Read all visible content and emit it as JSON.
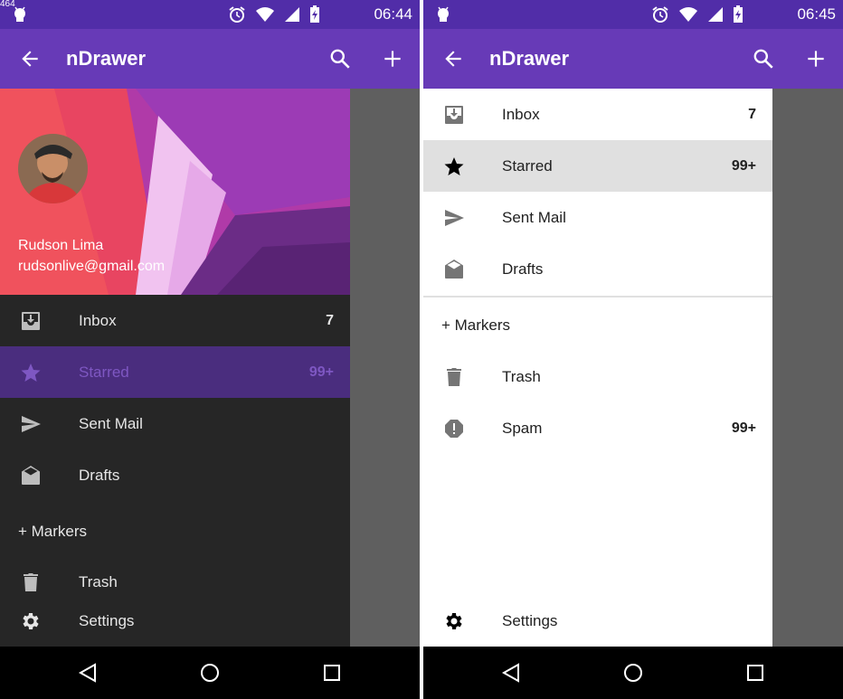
{
  "corner_label": "464",
  "app": {
    "title": "nDrawer"
  },
  "left": {
    "time": "06:44",
    "user": {
      "name": "Rudson Lima",
      "email": "rudsonlive@gmail.com"
    },
    "items": [
      {
        "label": "Inbox",
        "count": "7",
        "icon": "inbox-icon"
      },
      {
        "label": "Starred",
        "count": "99+",
        "icon": "star-icon"
      },
      {
        "label": "Sent Mail",
        "count": "",
        "icon": "send-icon"
      },
      {
        "label": "Drafts",
        "count": "",
        "icon": "drafts-icon"
      }
    ],
    "section": "+ Markers",
    "trash": {
      "label": "Trash",
      "icon": "trash-icon"
    },
    "settings": {
      "label": "Settings",
      "icon": "gear-icon"
    }
  },
  "right": {
    "time": "06:45",
    "items": [
      {
        "label": "Inbox",
        "count": "7",
        "icon": "inbox-icon"
      },
      {
        "label": "Starred",
        "count": "99+",
        "icon": "star-icon"
      },
      {
        "label": "Sent Mail",
        "count": "",
        "icon": "send-icon"
      },
      {
        "label": "Drafts",
        "count": "",
        "icon": "drafts-icon"
      }
    ],
    "section": "+ Markers",
    "trash": {
      "label": "Trash",
      "icon": "trash-icon"
    },
    "spam": {
      "label": "Spam",
      "count": "99+",
      "icon": "spam-icon"
    },
    "settings": {
      "label": "Settings",
      "icon": "gear-icon"
    }
  },
  "colors": {
    "primary": "#673ab7",
    "primary_dark": "#512da8",
    "accent": "#7e57c2",
    "drawer_dark": "#262626"
  }
}
